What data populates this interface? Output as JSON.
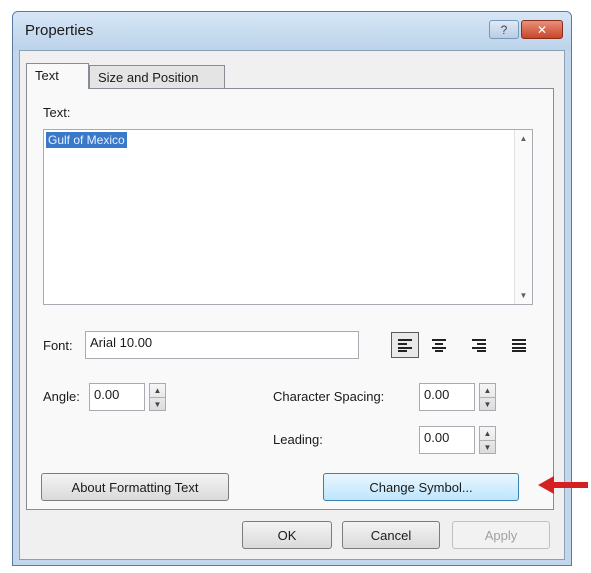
{
  "window": {
    "title": "Properties",
    "help_label": "?",
    "close_label": "✕"
  },
  "tabs": [
    {
      "label": "Text",
      "active": true
    },
    {
      "label": "Size and Position",
      "active": false
    }
  ],
  "text_section": {
    "label": "Text:",
    "value": "Gulf of Mexico"
  },
  "font": {
    "label": "Font:",
    "value": "Arial 10.00",
    "alignment_options": [
      "align-left",
      "align-center",
      "align-right",
      "align-justify"
    ],
    "selected_alignment": "align-left"
  },
  "angle": {
    "label": "Angle:",
    "value": "0.00"
  },
  "character_spacing": {
    "label": "Character Spacing:",
    "value": "0.00"
  },
  "leading": {
    "label": "Leading:",
    "value": "0.00"
  },
  "buttons": {
    "about": "About Formatting Text",
    "change_symbol": "Change Symbol...",
    "ok": "OK",
    "cancel": "Cancel",
    "apply": "Apply"
  },
  "colors": {
    "selection": "#3a78c8",
    "close_button": "#c8462a",
    "annotation_arrow": "#d42020"
  }
}
